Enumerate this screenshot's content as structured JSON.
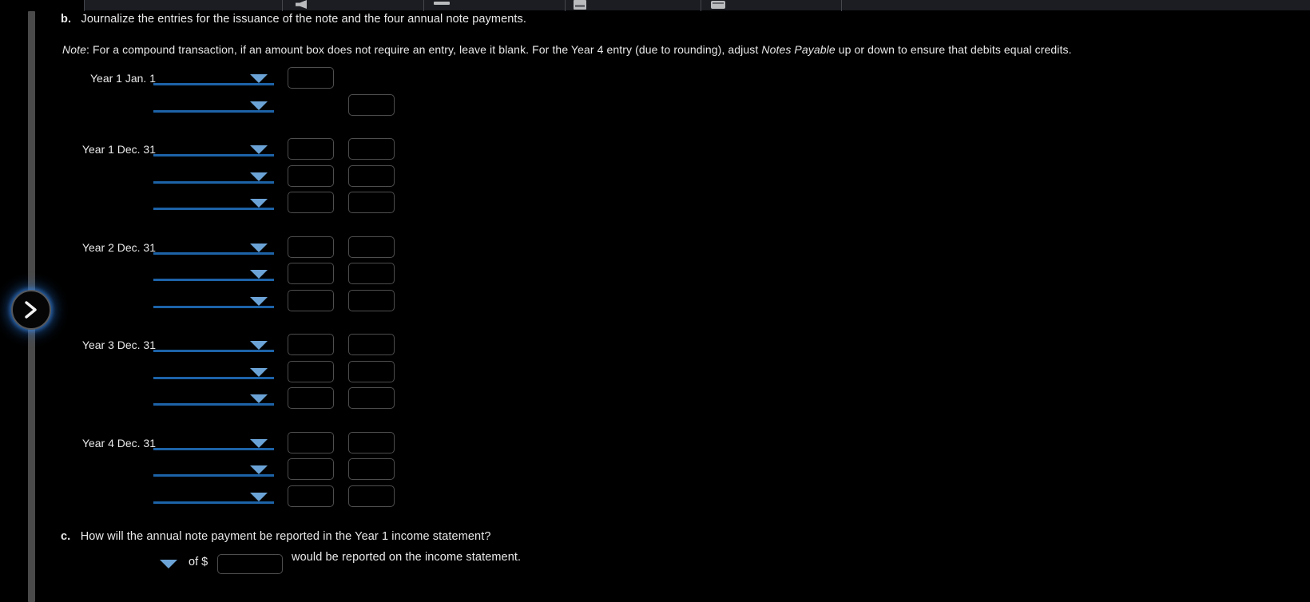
{
  "toolbar": {
    "icons": [
      "speaker-icon",
      "minimize-icon",
      "grid-icon",
      "window-icon"
    ]
  },
  "nav": {
    "next_button_label": "next-question"
  },
  "question_b": {
    "label": "b.",
    "text": "Journalize the entries for the issuance of the note and the four annual note payments.",
    "note_label": "Note",
    "note_part1": ": For a compound transaction, if an amount box does not require an entry, leave it blank. For the Year 4 entry (due to rounding), adjust ",
    "note_italic": "Notes Payable",
    "note_part2": " up or down to ensure that debits equal credits."
  },
  "journal": {
    "dropdown_placeholder": "",
    "debit_placeholder": "",
    "credit_placeholder": "",
    "groups": [
      {
        "date": "Year 1 Jan. 1",
        "rows": [
          {
            "account": "",
            "debit": "",
            "credit": "",
            "has_debit": true,
            "has_credit": false
          },
          {
            "account": "",
            "debit": "",
            "credit": "",
            "has_debit": false,
            "has_credit": true
          }
        ]
      },
      {
        "date": "Year 1 Dec. 31",
        "rows": [
          {
            "account": "",
            "debit": "",
            "credit": "",
            "has_debit": true,
            "has_credit": true
          },
          {
            "account": "",
            "debit": "",
            "credit": "",
            "has_debit": true,
            "has_credit": true
          },
          {
            "account": "",
            "debit": "",
            "credit": "",
            "has_debit": true,
            "has_credit": true
          }
        ]
      },
      {
        "date": "Year 2 Dec. 31",
        "rows": [
          {
            "account": "",
            "debit": "",
            "credit": "",
            "has_debit": true,
            "has_credit": true
          },
          {
            "account": "",
            "debit": "",
            "credit": "",
            "has_debit": true,
            "has_credit": true
          },
          {
            "account": "",
            "debit": "",
            "credit": "",
            "has_debit": true,
            "has_credit": true
          }
        ]
      },
      {
        "date": "Year 3 Dec. 31",
        "rows": [
          {
            "account": "",
            "debit": "",
            "credit": "",
            "has_debit": true,
            "has_credit": true
          },
          {
            "account": "",
            "debit": "",
            "credit": "",
            "has_debit": true,
            "has_credit": true
          },
          {
            "account": "",
            "debit": "",
            "credit": "",
            "has_debit": true,
            "has_credit": true
          }
        ]
      },
      {
        "date": "Year 4 Dec. 31",
        "rows": [
          {
            "account": "",
            "debit": "",
            "credit": "",
            "has_debit": true,
            "has_credit": true
          },
          {
            "account": "",
            "debit": "",
            "credit": "",
            "has_debit": true,
            "has_credit": true
          },
          {
            "account": "",
            "debit": "",
            "credit": "",
            "has_debit": true,
            "has_credit": true
          }
        ]
      }
    ]
  },
  "question_c": {
    "label": "c.",
    "text": "How will the annual note payment be reported in the Year 1 income statement?",
    "of_label": "of $",
    "amount_value": "",
    "tail_text": "would be reported on the income statement."
  },
  "colors": {
    "background": "#000000",
    "text": "#e9e9e9",
    "dropdown_bar": "#1d63a8",
    "dropdown_caret": "#6ba3d6",
    "input_border": "#4e4e4e",
    "scrollbar": "#4a4a4a",
    "glow": "#2878dc"
  }
}
